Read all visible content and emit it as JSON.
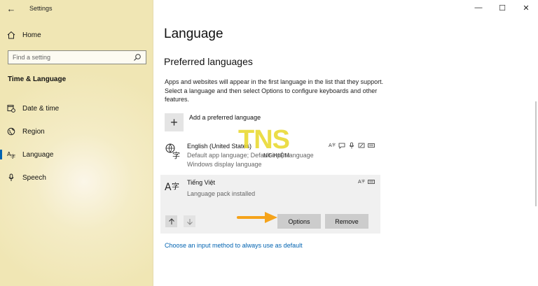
{
  "window": {
    "app_title": "Settings",
    "controls": {
      "minimize": "—",
      "maximize": "☐",
      "close": "✕"
    }
  },
  "sidebar": {
    "home_label": "Home",
    "search_placeholder": "Find a setting",
    "section_title": "Time & Language",
    "items": [
      {
        "label": "Date & time",
        "icon": "calendar-clock-icon"
      },
      {
        "label": "Region",
        "icon": "globe-icon"
      },
      {
        "label": "Language",
        "icon": "language-icon",
        "active": true
      },
      {
        "label": "Speech",
        "icon": "microphone-icon"
      }
    ]
  },
  "main": {
    "title": "Language",
    "subtitle": "Preferred languages",
    "description": "Apps and websites will appear in the first language in the list that they support. Select a language and then select Options to configure keyboards and other features.",
    "add_label": "Add a preferred language",
    "languages": [
      {
        "name": "English (United States)",
        "lines": [
          "Default app language; Default input language",
          "Windows display language"
        ]
      },
      {
        "name": "Tiếng Việt",
        "lines": [
          "Language pack installed"
        ],
        "options_label": "Options",
        "remove_label": "Remove"
      }
    ],
    "input_method_link": "Choose an input method to always use as default"
  },
  "watermark": {
    "logo": "TNS",
    "sub": "NGHIỆM"
  },
  "colors": {
    "accent": "#0063b1",
    "sidebar_bg": "#f2e9bd",
    "arrow": "#f5a31a"
  }
}
